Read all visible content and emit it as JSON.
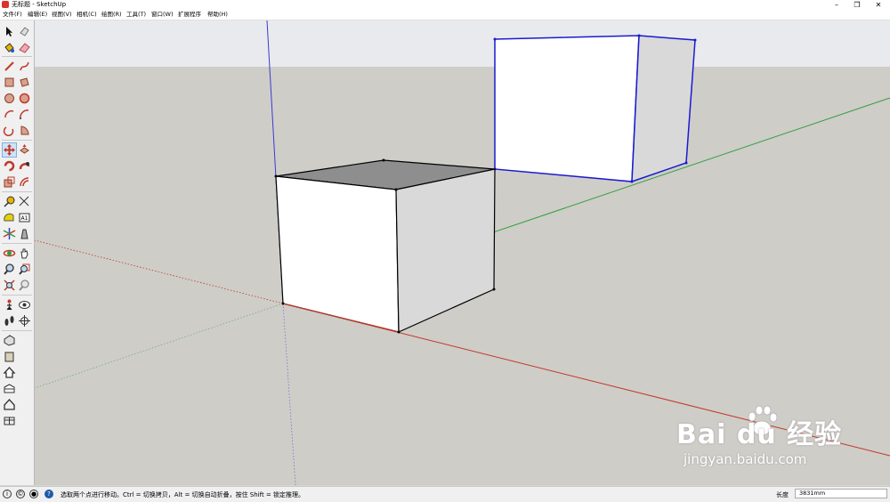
{
  "window": {
    "title": "无标题 - SketchUp",
    "minimize_glyph": "–",
    "restore_glyph": "❐",
    "close_glyph": "✕"
  },
  "menu": [
    {
      "label": "文件(F)"
    },
    {
      "label": "编辑(E)"
    },
    {
      "label": "视图(V)"
    },
    {
      "label": "相机(C)"
    },
    {
      "label": "绘图(R)"
    },
    {
      "label": "工具(T)"
    },
    {
      "label": "窗口(W)"
    },
    {
      "label": "扩展程序"
    },
    {
      "label": "帮助(H)"
    }
  ],
  "toolbar": {
    "tools": [
      "select-icon",
      "eraser-icon",
      "paint-bucket-icon",
      "rubber-icon",
      "line-icon",
      "freehand-icon",
      "rectangle-icon",
      "rotated-rectangle-icon",
      "circle-icon",
      "polygon-icon",
      "arc-icon",
      "two-point-arc-icon",
      "three-point-arc-icon",
      "pie-icon",
      "move-icon",
      "push-pull-icon",
      "rotate-icon",
      "follow-me-icon",
      "scale-icon",
      "offset-icon",
      "tape-measure-icon",
      "dimension-icon",
      "protractor-icon",
      "text-icon",
      "axes-icon",
      "3d-text-icon",
      "orbit-icon",
      "pan-icon",
      "zoom-icon",
      "zoom-window-icon",
      "zoom-extents-icon",
      "previous-view-icon",
      "position-camera-icon",
      "look-around-icon",
      "walk-icon",
      "section-plane-icon",
      "warehouse-icon",
      "extension-icon",
      "house-icon",
      "share-model-icon",
      "house-outline-icon",
      "components-icon"
    ],
    "active_tool": "move-icon"
  },
  "statusbar": {
    "hint": "选取两个点进行移动。Ctrl = 切换拷贝，Alt = 切换自动折叠，按住 Shift = 锁定推理。",
    "measure_label": "长度",
    "measure_value": "3831mm",
    "icons": [
      "info-icon",
      "credit-icon",
      "user-icon",
      "help-icon"
    ]
  },
  "scene": {
    "sky_color": "#e9eaed",
    "ground_color": "#cfcdc8",
    "axis_colors": {
      "red": "#c0392b",
      "green": "#2e9e3e",
      "blue": "#3a3ad0"
    },
    "selection_color": "#1a1ad0"
  },
  "watermark": {
    "brand": "Bai du 经验",
    "url": "jingyan.baidu.com"
  }
}
